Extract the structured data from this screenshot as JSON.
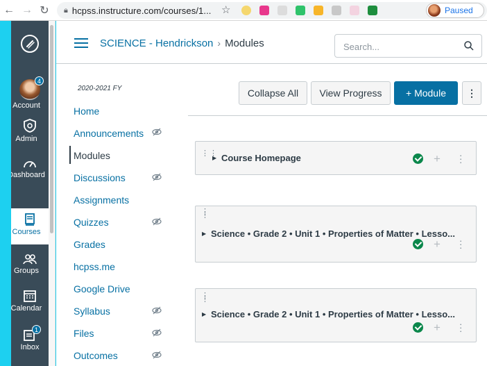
{
  "browser": {
    "url": "hcpss.instructure.com/courses/1...",
    "profile_status": "Paused"
  },
  "global_nav": {
    "items": [
      {
        "label": "Account",
        "badge": "4"
      },
      {
        "label": "Admin"
      },
      {
        "label": "Dashboard"
      },
      {
        "label": "Courses"
      },
      {
        "label": "Groups"
      },
      {
        "label": "Calendar"
      },
      {
        "label": "Inbox",
        "badge": "1"
      }
    ]
  },
  "header": {
    "course_link": "SCIENCE - Hendrickson",
    "separator": "›",
    "current_page": "Modules",
    "search_placeholder": "Search..."
  },
  "course_nav": {
    "term": "2020-2021 FY",
    "items": [
      {
        "label": "Home",
        "hidden": false
      },
      {
        "label": "Announcements",
        "hidden": true
      },
      {
        "label": "Modules",
        "hidden": false,
        "active": true
      },
      {
        "label": "Discussions",
        "hidden": true
      },
      {
        "label": "Assignments",
        "hidden": false
      },
      {
        "label": "Quizzes",
        "hidden": true
      },
      {
        "label": "Grades",
        "hidden": false
      },
      {
        "label": "hcpss.me",
        "hidden": false
      },
      {
        "label": "Google Drive",
        "hidden": false
      },
      {
        "label": "Syllabus",
        "hidden": true
      },
      {
        "label": "Files",
        "hidden": true
      },
      {
        "label": "Outcomes",
        "hidden": true
      }
    ]
  },
  "toolbar": {
    "collapse_all": "Collapse All",
    "view_progress": "View Progress",
    "add_module": "+ Module",
    "more": "⋮"
  },
  "modules": [
    {
      "title": "Course Homepage",
      "published": true
    },
    {
      "title": "Science • Grade 2 • Unit 1 • Properties of Matter • Lesso...",
      "published": true
    },
    {
      "title": "Science • Grade 2 • Unit 1 • Properties of Matter • Lesso...",
      "published": true
    }
  ],
  "colors": {
    "brand_blue": "#0770a3",
    "nav_dark": "#394b58",
    "published_green": "#0b874b",
    "outer_background": "#1dd0f0"
  }
}
